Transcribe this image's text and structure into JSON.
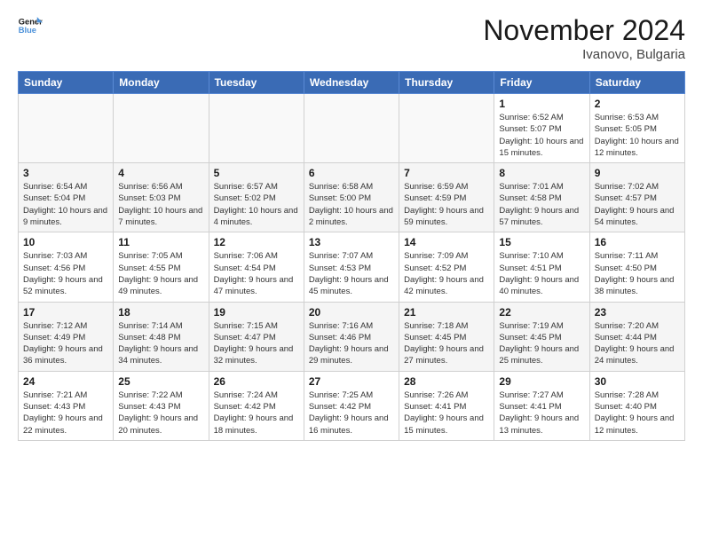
{
  "logo": {
    "line1": "General",
    "line2": "Blue"
  },
  "title": "November 2024",
  "location": "Ivanovo, Bulgaria",
  "days_of_week": [
    "Sunday",
    "Monday",
    "Tuesday",
    "Wednesday",
    "Thursday",
    "Friday",
    "Saturday"
  ],
  "weeks": [
    [
      {
        "day": "",
        "info": ""
      },
      {
        "day": "",
        "info": ""
      },
      {
        "day": "",
        "info": ""
      },
      {
        "day": "",
        "info": ""
      },
      {
        "day": "",
        "info": ""
      },
      {
        "day": "1",
        "info": "Sunrise: 6:52 AM\nSunset: 5:07 PM\nDaylight: 10 hours and 15 minutes."
      },
      {
        "day": "2",
        "info": "Sunrise: 6:53 AM\nSunset: 5:05 PM\nDaylight: 10 hours and 12 minutes."
      }
    ],
    [
      {
        "day": "3",
        "info": "Sunrise: 6:54 AM\nSunset: 5:04 PM\nDaylight: 10 hours and 9 minutes."
      },
      {
        "day": "4",
        "info": "Sunrise: 6:56 AM\nSunset: 5:03 PM\nDaylight: 10 hours and 7 minutes."
      },
      {
        "day": "5",
        "info": "Sunrise: 6:57 AM\nSunset: 5:02 PM\nDaylight: 10 hours and 4 minutes."
      },
      {
        "day": "6",
        "info": "Sunrise: 6:58 AM\nSunset: 5:00 PM\nDaylight: 10 hours and 2 minutes."
      },
      {
        "day": "7",
        "info": "Sunrise: 6:59 AM\nSunset: 4:59 PM\nDaylight: 9 hours and 59 minutes."
      },
      {
        "day": "8",
        "info": "Sunrise: 7:01 AM\nSunset: 4:58 PM\nDaylight: 9 hours and 57 minutes."
      },
      {
        "day": "9",
        "info": "Sunrise: 7:02 AM\nSunset: 4:57 PM\nDaylight: 9 hours and 54 minutes."
      }
    ],
    [
      {
        "day": "10",
        "info": "Sunrise: 7:03 AM\nSunset: 4:56 PM\nDaylight: 9 hours and 52 minutes."
      },
      {
        "day": "11",
        "info": "Sunrise: 7:05 AM\nSunset: 4:55 PM\nDaylight: 9 hours and 49 minutes."
      },
      {
        "day": "12",
        "info": "Sunrise: 7:06 AM\nSunset: 4:54 PM\nDaylight: 9 hours and 47 minutes."
      },
      {
        "day": "13",
        "info": "Sunrise: 7:07 AM\nSunset: 4:53 PM\nDaylight: 9 hours and 45 minutes."
      },
      {
        "day": "14",
        "info": "Sunrise: 7:09 AM\nSunset: 4:52 PM\nDaylight: 9 hours and 42 minutes."
      },
      {
        "day": "15",
        "info": "Sunrise: 7:10 AM\nSunset: 4:51 PM\nDaylight: 9 hours and 40 minutes."
      },
      {
        "day": "16",
        "info": "Sunrise: 7:11 AM\nSunset: 4:50 PM\nDaylight: 9 hours and 38 minutes."
      }
    ],
    [
      {
        "day": "17",
        "info": "Sunrise: 7:12 AM\nSunset: 4:49 PM\nDaylight: 9 hours and 36 minutes."
      },
      {
        "day": "18",
        "info": "Sunrise: 7:14 AM\nSunset: 4:48 PM\nDaylight: 9 hours and 34 minutes."
      },
      {
        "day": "19",
        "info": "Sunrise: 7:15 AM\nSunset: 4:47 PM\nDaylight: 9 hours and 32 minutes."
      },
      {
        "day": "20",
        "info": "Sunrise: 7:16 AM\nSunset: 4:46 PM\nDaylight: 9 hours and 29 minutes."
      },
      {
        "day": "21",
        "info": "Sunrise: 7:18 AM\nSunset: 4:45 PM\nDaylight: 9 hours and 27 minutes."
      },
      {
        "day": "22",
        "info": "Sunrise: 7:19 AM\nSunset: 4:45 PM\nDaylight: 9 hours and 25 minutes."
      },
      {
        "day": "23",
        "info": "Sunrise: 7:20 AM\nSunset: 4:44 PM\nDaylight: 9 hours and 24 minutes."
      }
    ],
    [
      {
        "day": "24",
        "info": "Sunrise: 7:21 AM\nSunset: 4:43 PM\nDaylight: 9 hours and 22 minutes."
      },
      {
        "day": "25",
        "info": "Sunrise: 7:22 AM\nSunset: 4:43 PM\nDaylight: 9 hours and 20 minutes."
      },
      {
        "day": "26",
        "info": "Sunrise: 7:24 AM\nSunset: 4:42 PM\nDaylight: 9 hours and 18 minutes."
      },
      {
        "day": "27",
        "info": "Sunrise: 7:25 AM\nSunset: 4:42 PM\nDaylight: 9 hours and 16 minutes."
      },
      {
        "day": "28",
        "info": "Sunrise: 7:26 AM\nSunset: 4:41 PM\nDaylight: 9 hours and 15 minutes."
      },
      {
        "day": "29",
        "info": "Sunrise: 7:27 AM\nSunset: 4:41 PM\nDaylight: 9 hours and 13 minutes."
      },
      {
        "day": "30",
        "info": "Sunrise: 7:28 AM\nSunset: 4:40 PM\nDaylight: 9 hours and 12 minutes."
      }
    ]
  ]
}
